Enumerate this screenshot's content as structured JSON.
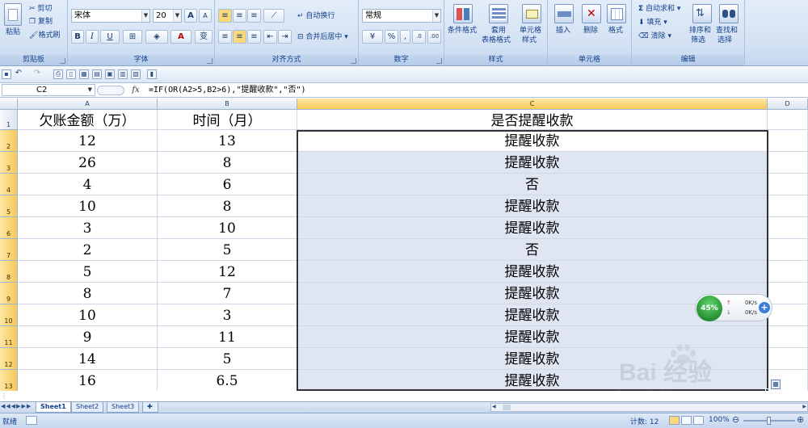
{
  "ribbon": {
    "clipboard": {
      "label": "剪贴板",
      "paste": "粘贴",
      "cut": "剪切",
      "copy": "复制",
      "format_painter": "格式刷"
    },
    "font": {
      "label": "字体",
      "name": "宋体",
      "size": "20",
      "bold": "B",
      "italic": "I",
      "underline": "U",
      "grow": "A",
      "shrink": "A",
      "font_color": "A",
      "phonetic": "变"
    },
    "alignment": {
      "label": "对齐方式",
      "wrap": "自动换行",
      "merge": "合并后居中"
    },
    "number": {
      "label": "数字",
      "format": "常规",
      "percent": "%",
      "comma": ","
    },
    "styles": {
      "label": "样式",
      "conditional": "条件格式",
      "table1": "套用",
      "table2": "表格格式",
      "cell1": "单元格",
      "cell2": "样式"
    },
    "cells": {
      "label": "单元格",
      "insert": "插入",
      "delete": "删除",
      "format": "格式"
    },
    "editing": {
      "label": "编辑",
      "autosum": "自动求和",
      "fill": "填充",
      "clear": "清除",
      "sort1": "排序和",
      "sort2": "筛选",
      "find1": "查找和",
      "find2": "选择"
    }
  },
  "formula_bar": {
    "name_box": "C2",
    "fx": "fx",
    "formula": "=IF(OR(A2>5,B2>6),\"提醒收款\",\"否\")"
  },
  "columns": [
    "A",
    "B",
    "C",
    "D"
  ],
  "row_numbers": [
    "1",
    "2",
    "3",
    "4",
    "5",
    "6",
    "7",
    "8",
    "9",
    "10",
    "11",
    "12",
    "13"
  ],
  "headers": [
    "欠账金额（万）",
    "时间（月）",
    "是否提醒收款"
  ],
  "rows": [
    [
      "12",
      "13",
      "提醒收款"
    ],
    [
      "26",
      "8",
      "提醒收款"
    ],
    [
      "4",
      "6",
      "否"
    ],
    [
      "10",
      "8",
      "提醒收款"
    ],
    [
      "3",
      "10",
      "提醒收款"
    ],
    [
      "2",
      "5",
      "否"
    ],
    [
      "5",
      "12",
      "提醒收款"
    ],
    [
      "8",
      "7",
      "提醒收款"
    ],
    [
      "10",
      "3",
      "提醒收款"
    ],
    [
      "9",
      "11",
      "提醒收款"
    ],
    [
      "14",
      "5",
      "提醒收款"
    ],
    [
      "16",
      "6.5",
      "提醒收款"
    ]
  ],
  "sheets": [
    "Sheet1",
    "Sheet2",
    "Sheet3"
  ],
  "status": {
    "ready": "就绪",
    "count": "计数: 12",
    "zoom": "100%"
  },
  "net_widget": {
    "percent": "45%",
    "up": "0K/s",
    "down": "0K/s"
  },
  "watermark": {
    "text": "Bai 经验",
    "url": "jingyan.baidu.com"
  },
  "colors": {
    "selection_fill": "#dfe6f2",
    "selected_header": "#f8c859",
    "ribbon_bg": "#d3e1f3",
    "widget_green": "#2e9b3a"
  }
}
